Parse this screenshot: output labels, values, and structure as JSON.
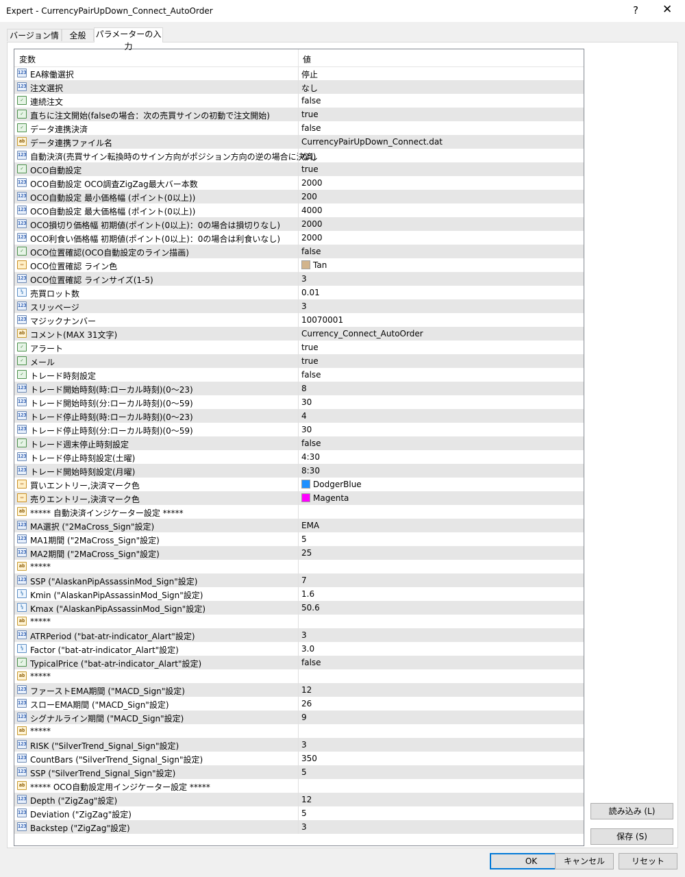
{
  "window": {
    "title": "Expert - CurrencyPairUpDown_Connect_AutoOrder",
    "help_glyph": "?",
    "close_glyph": "✕"
  },
  "tabs": [
    {
      "label": "バージョン情報"
    },
    {
      "label": "全般"
    },
    {
      "label": "パラメーターの入力",
      "active": true
    }
  ],
  "grid": {
    "header_name": "変数",
    "header_value": "値",
    "rows": [
      {
        "type": "int",
        "name": "EA稼働選択",
        "value": "停止"
      },
      {
        "type": "int",
        "name": "注文選択",
        "value": "なし"
      },
      {
        "type": "bool",
        "name": "連続注文",
        "value": "false"
      },
      {
        "type": "bool",
        "name": "直ちに注文開始(falseの場合：次の売買サインの初動で注文開始)",
        "value": "true"
      },
      {
        "type": "bool",
        "name": "データ連携決済",
        "value": "false"
      },
      {
        "type": "str",
        "name": "データ連携ファイル名",
        "value": "CurrencyPairUpDown_Connect.dat"
      },
      {
        "type": "int",
        "name": "自動決済(売買サイン転換時のサイン方向がポジション方向の逆の場合に決済)",
        "value": "なし"
      },
      {
        "type": "bool",
        "name": "OCO自動設定",
        "value": "true"
      },
      {
        "type": "int",
        "name": "OCO自動設定 OCO調査ZigZag最大バー本数",
        "value": "2000"
      },
      {
        "type": "int",
        "name": "OCO自動設定 最小価格幅 (ポイント(0以上))",
        "value": "200"
      },
      {
        "type": "int",
        "name": "OCO自動設定 最大価格幅 (ポイント(0以上))",
        "value": "4000"
      },
      {
        "type": "int",
        "name": "OCO損切り価格幅 初期値(ポイント(0以上)：0の場合は損切りなし)",
        "value": "2000"
      },
      {
        "type": "int",
        "name": "OCO利食い価格幅 初期値(ポイント(0以上)：0の場合は利食いなし)",
        "value": "2000"
      },
      {
        "type": "bool",
        "name": "OCO位置確認(OCO自動設定のライン描画)",
        "value": "false"
      },
      {
        "type": "color",
        "name": "OCO位置確認 ライン色",
        "value": "Tan",
        "swatch": "#d2b48c"
      },
      {
        "type": "int",
        "name": "OCO位置確認 ラインサイズ(1-5)",
        "value": "3"
      },
      {
        "type": "dbl",
        "name": "売買ロット数",
        "value": "0.01"
      },
      {
        "type": "int",
        "name": "スリッページ",
        "value": "3"
      },
      {
        "type": "int",
        "name": "マジックナンバー",
        "value": "10070001"
      },
      {
        "type": "str",
        "name": "コメント(MAX 31文字)",
        "value": "Currency_Connect_AutoOrder"
      },
      {
        "type": "bool",
        "name": "アラート",
        "value": "true"
      },
      {
        "type": "bool",
        "name": "メール",
        "value": "true"
      },
      {
        "type": "bool",
        "name": "トレード時刻設定",
        "value": "false"
      },
      {
        "type": "int",
        "name": "トレード開始時刻(時:ローカル時刻)(0〜23)",
        "value": "8"
      },
      {
        "type": "int",
        "name": "トレード開始時刻(分:ローカル時刻)(0〜59)",
        "value": "30"
      },
      {
        "type": "int",
        "name": "トレード停止時刻(時:ローカル時刻)(0〜23)",
        "value": "4"
      },
      {
        "type": "int",
        "name": "トレード停止時刻(分:ローカル時刻)(0〜59)",
        "value": "30"
      },
      {
        "type": "bool",
        "name": "トレード週末停止時刻設定",
        "value": "false"
      },
      {
        "type": "int",
        "name": "トレード停止時刻設定(土曜)",
        "value": "4:30"
      },
      {
        "type": "int",
        "name": "トレード開始時刻設定(月曜)",
        "value": "8:30"
      },
      {
        "type": "color",
        "name": "買いエントリー,決済マーク色",
        "value": "DodgerBlue",
        "swatch": "#1e90ff"
      },
      {
        "type": "color",
        "name": "売りエントリー,決済マーク色",
        "value": "Magenta",
        "swatch": "#ff00ff"
      },
      {
        "type": "str",
        "name": "***** 自動決済インジケーター設定 *****",
        "value": ""
      },
      {
        "type": "int",
        "name": "MA選択 (\"2MaCross_Sign\"設定)",
        "value": "EMA"
      },
      {
        "type": "int",
        "name": "MA1期間 (\"2MaCross_Sign\"設定)",
        "value": "5"
      },
      {
        "type": "int",
        "name": "MA2期間 (\"2MaCross_Sign\"設定)",
        "value": "25"
      },
      {
        "type": "str",
        "name": "*****",
        "value": ""
      },
      {
        "type": "int",
        "name": "SSP (\"AlaskanPipAssassinMod_Sign\"設定)",
        "value": "7"
      },
      {
        "type": "dbl",
        "name": "Kmin (\"AlaskanPipAssassinMod_Sign\"設定)",
        "value": "1.6"
      },
      {
        "type": "dbl",
        "name": "Kmax (\"AlaskanPipAssassinMod_Sign\"設定)",
        "value": "50.6"
      },
      {
        "type": "str",
        "name": "*****",
        "value": ""
      },
      {
        "type": "int",
        "name": "ATRPeriod (\"bat-atr-indicator_Alart\"設定)",
        "value": "3"
      },
      {
        "type": "dbl",
        "name": "Factor (\"bat-atr-indicator_Alart\"設定)",
        "value": "3.0"
      },
      {
        "type": "bool",
        "name": "TypicalPrice (\"bat-atr-indicator_Alart\"設定)",
        "value": "false"
      },
      {
        "type": "str",
        "name": "*****",
        "value": ""
      },
      {
        "type": "int",
        "name": "ファーストEMA期間 (\"MACD_Sign\"設定)",
        "value": "12"
      },
      {
        "type": "int",
        "name": "スローEMA期間 (\"MACD_Sign\"設定)",
        "value": "26"
      },
      {
        "type": "int",
        "name": "シグナルライン期間 (\"MACD_Sign\"設定)",
        "value": "9"
      },
      {
        "type": "str",
        "name": "*****",
        "value": ""
      },
      {
        "type": "int",
        "name": "RISK (\"SilverTrend_Signal_Sign\"設定)",
        "value": "3"
      },
      {
        "type": "int",
        "name": "CountBars (\"SilverTrend_Signal_Sign\"設定)",
        "value": "350"
      },
      {
        "type": "int",
        "name": "SSP (\"SilverTrend_Signal_Sign\"設定)",
        "value": "5"
      },
      {
        "type": "str",
        "name": "***** OCO自動設定用インジケーター設定 *****",
        "value": ""
      },
      {
        "type": "int",
        "name": "Depth (\"ZigZag\"設定)",
        "value": "12"
      },
      {
        "type": "int",
        "name": "Deviation (\"ZigZag\"設定)",
        "value": "5"
      },
      {
        "type": "int",
        "name": "Backstep (\"ZigZag\"設定)",
        "value": "3"
      }
    ]
  },
  "icons": {
    "int": {
      "name": "integer-type-icon",
      "glyph": "123"
    },
    "bool": {
      "name": "boolean-type-icon",
      "glyph": "✓"
    },
    "str": {
      "name": "string-type-icon",
      "glyph": "ab"
    },
    "dbl": {
      "name": "double-type-icon",
      "glyph": "½"
    },
    "color": {
      "name": "color-type-icon",
      "glyph": "▭"
    }
  },
  "buttons": {
    "load": "読み込み (L)",
    "save": "保存 (S)",
    "ok": "OK",
    "cancel": "キャンセル",
    "reset": "リセット"
  }
}
